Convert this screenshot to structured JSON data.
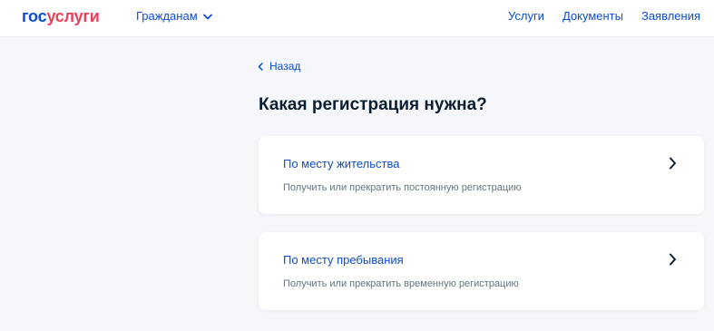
{
  "header": {
    "logo": {
      "part1": "гос",
      "part2": "услуги"
    },
    "audience_label": "Гражданам",
    "nav": [
      "Услуги",
      "Документы",
      "Заявления"
    ]
  },
  "back_label": "Назад",
  "page_title": "Какая регистрация нужна?",
  "cards": [
    {
      "title": "По месту жительства",
      "description": "Получить или прекратить постоянную регистрацию"
    },
    {
      "title": "По месту пребывания",
      "description": "Получить или прекратить временную регистрацию"
    }
  ],
  "colors": {
    "brand_blue": "#0d4cd3",
    "brand_red": "#ee3f58",
    "text_dark": "#0b1f33",
    "text_muted": "#66727f",
    "background": "#f5f7fa"
  },
  "icons": [
    "chevron-down-icon",
    "chevron-left-icon",
    "chevron-right-icon"
  ]
}
